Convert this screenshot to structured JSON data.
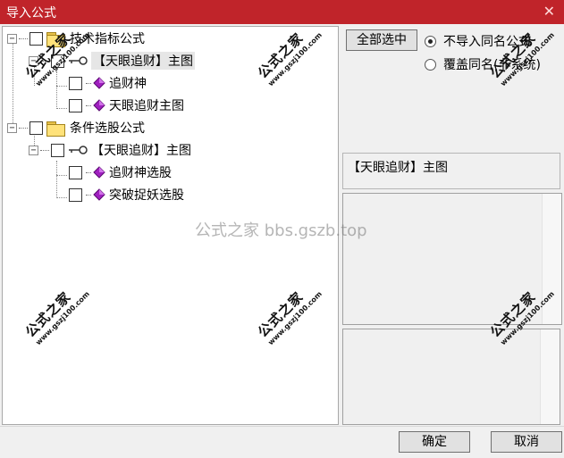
{
  "window": {
    "title": "导入公式",
    "close_glyph": "✕"
  },
  "tree": {
    "nodes": [
      {
        "label": "技术指标公式",
        "type": "folder",
        "expander": "−"
      },
      {
        "label": "【天眼追财】主图",
        "type": "key",
        "expander": "−"
      },
      {
        "label": "追财神",
        "type": "gem"
      },
      {
        "label": "天眼追财主图",
        "type": "gem"
      },
      {
        "label": "条件选股公式",
        "type": "folder",
        "expander": "−"
      },
      {
        "label": "【天眼追财】主图",
        "type": "key",
        "expander": "−"
      },
      {
        "label": "追财神选股",
        "type": "gem"
      },
      {
        "label": "突破捉妖选股",
        "type": "gem"
      }
    ]
  },
  "controls": {
    "select_all_label": "全部选中",
    "radio_options": [
      {
        "label": "不导入同名公式",
        "checked": true
      },
      {
        "label": "覆盖同名(非系统)",
        "checked": false
      }
    ]
  },
  "info": {
    "selected_name": "【天眼追财】主图"
  },
  "footer": {
    "ok_label": "确定",
    "cancel_label": "取消"
  },
  "watermark": {
    "center_text": "公式之家 bbs.gszb.top",
    "stamp_big": "公式之家",
    "stamp_small": "www.gszj100.com"
  },
  "colors": {
    "titlebar": "#c0242a",
    "gem": "#a020c0"
  }
}
